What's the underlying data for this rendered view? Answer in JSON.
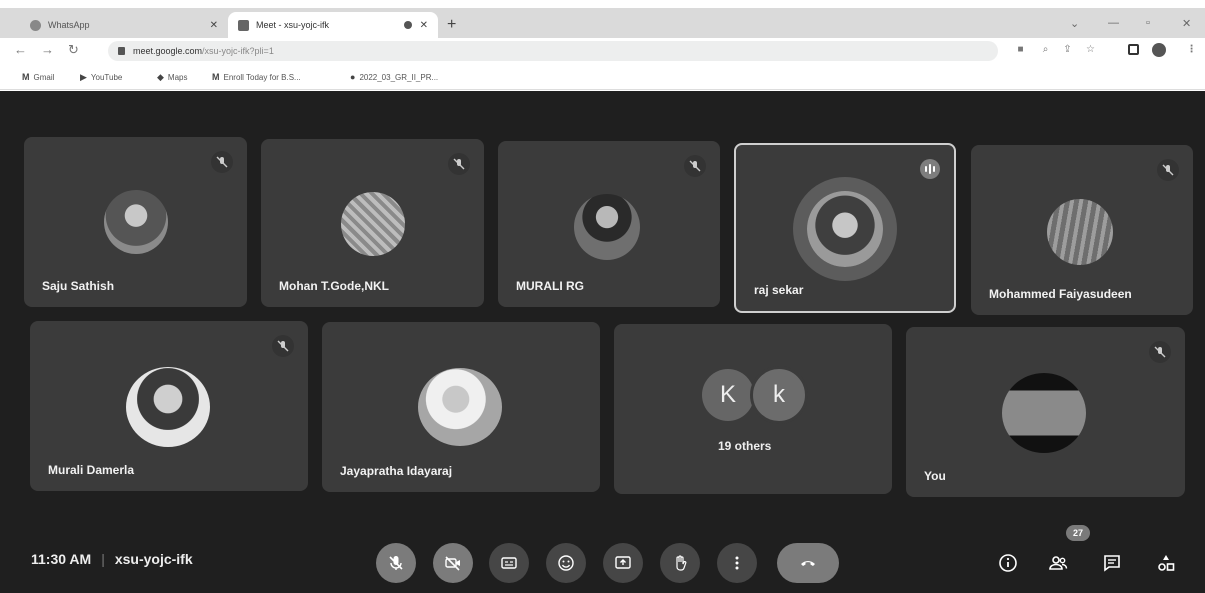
{
  "browser": {
    "tabs": [
      {
        "title": "WhatsApp"
      },
      {
        "title": "Meet - xsu-yojc-ifk"
      }
    ],
    "new_tab": "+",
    "url_host": "meet.google.com",
    "url_path": "/xsu-yojc-ifk?pli=1",
    "bookmarks": [
      {
        "label": "Gmail"
      },
      {
        "label": "YouTube"
      },
      {
        "label": "Maps"
      },
      {
        "label": "Enroll Today for B.S..."
      },
      {
        "label": "2022_03_GR_II_PR..."
      }
    ]
  },
  "meeting": {
    "participants_row1": [
      {
        "name": "Saju Sathish",
        "muted": true
      },
      {
        "name": "Mohan T.Gode,NKL",
        "muted": true
      },
      {
        "name": "MURALI RG",
        "muted": true
      },
      {
        "name": "raj sekar",
        "muted": false,
        "speaking": true
      },
      {
        "name": "Mohammed Faiyasudeen",
        "muted": true
      }
    ],
    "participants_row2": [
      {
        "name": "Murali Damerla",
        "muted": true
      },
      {
        "name": "Jayapratha Idayaraj",
        "muted": false
      },
      {
        "name": "You",
        "muted": true
      }
    ],
    "others": {
      "initials": [
        "K",
        "k"
      ],
      "label": "19 others"
    },
    "time": "11:30 AM",
    "separator": "|",
    "code": "xsu-yojc-ifk",
    "participant_count": "27"
  },
  "colors": {
    "stage_bg": "#1f1f1f",
    "tile_bg": "#3b3b3b",
    "control_bg": "#464646",
    "control_active": "#7b7b7b"
  }
}
